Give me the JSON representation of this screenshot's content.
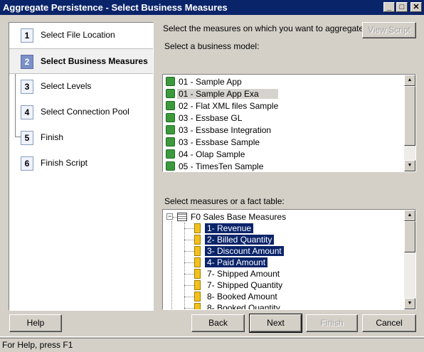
{
  "window": {
    "title": "Aggregate Persistence - Select Business Measures",
    "minimize_glyph": "_",
    "maximize_glyph": "□",
    "close_glyph": "✕"
  },
  "steps": [
    {
      "num": "1",
      "label": "Select File Location"
    },
    {
      "num": "2",
      "label": "Select Business Measures",
      "active": true
    },
    {
      "num": "3",
      "label": "Select Levels"
    },
    {
      "num": "4",
      "label": "Select Connection Pool"
    },
    {
      "num": "5",
      "label": "Finish"
    },
    {
      "num": "6",
      "label": "Finish Script"
    }
  ],
  "main": {
    "instruction": "Select the measures on which you want to aggregate.",
    "view_script_label": "View Script",
    "business_model_label": "Select a business model:",
    "measures_label": "Select measures or a fact table:"
  },
  "business_models": [
    {
      "label": "01 - Sample App",
      "icon": "business-model-icon"
    },
    {
      "label": "01 - Sample App Exa",
      "icon": "business-model-icon",
      "selected": true
    },
    {
      "label": "02 - Flat XML files Sample",
      "icon": "business-model-icon"
    },
    {
      "label": "03 - Essbase GL",
      "icon": "business-model-icon"
    },
    {
      "label": "03 - Essbase Integration",
      "icon": "business-model-icon"
    },
    {
      "label": "03 - Essbase Sample",
      "icon": "business-model-icon"
    },
    {
      "label": "04 - Olap Sample",
      "icon": "business-model-icon"
    },
    {
      "label": "05 - TimesTen Sample",
      "icon": "business-model-icon"
    }
  ],
  "fact_table": {
    "label": "F0 Sales Base Measures",
    "icon": "fact-table-icon",
    "measures": [
      {
        "label": "1- Revenue",
        "selected": true
      },
      {
        "label": "2- Billed Quantity",
        "selected": true
      },
      {
        "label": "3- Discount Amount",
        "selected": true
      },
      {
        "label": "4- Paid Amount",
        "selected": true
      },
      {
        "label": "7- Shipped Amount",
        "selected": false
      },
      {
        "label": "7- Shipped Quantity",
        "selected": false
      },
      {
        "label": "8- Booked Amount",
        "selected": false
      },
      {
        "label": "8- Booked Quantity",
        "selected": false
      }
    ]
  },
  "buttons": {
    "help": "Help",
    "back": "Back",
    "next": "Next",
    "finish": "Finish",
    "cancel": "Cancel"
  },
  "status_text": "For Help, press F1"
}
